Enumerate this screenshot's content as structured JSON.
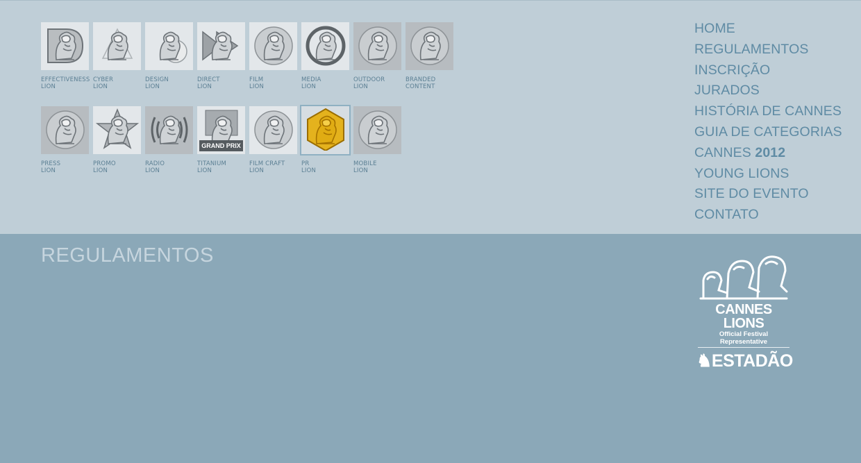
{
  "categories_row1": [
    {
      "l1": "EFFECTIVENESS",
      "l2": "LION",
      "style": "light",
      "icon": "effectiveness-lion-icon"
    },
    {
      "l1": "CYBER",
      "l2": "LION",
      "style": "light",
      "icon": "cyber-lion-icon"
    },
    {
      "l1": "DESIGN",
      "l2": "LION",
      "style": "light",
      "icon": "design-lion-icon"
    },
    {
      "l1": "DIRECT",
      "l2": "LION",
      "style": "light",
      "icon": "direct-lion-icon"
    },
    {
      "l1": "FILM",
      "l2": "LION",
      "style": "light",
      "icon": "film-lion-icon"
    },
    {
      "l1": "MEDIA",
      "l2": "LION",
      "style": "light",
      "icon": "media-lion-icon"
    },
    {
      "l1": "OUTDOOR",
      "l2": "LION",
      "style": "mid",
      "icon": "outdoor-lion-icon"
    },
    {
      "l1": "BRANDED",
      "l2": "CONTENT",
      "style": "mid",
      "icon": "branded-content-lion-icon"
    }
  ],
  "categories_row2": [
    {
      "l1": "PRESS",
      "l2": "LION",
      "style": "mid",
      "icon": "press-lion-icon"
    },
    {
      "l1": "PROMO",
      "l2": "LION",
      "style": "light",
      "icon": "promo-lion-icon"
    },
    {
      "l1": "RADIO",
      "l2": "LION",
      "style": "mid",
      "icon": "radio-lion-icon"
    },
    {
      "l1": "TITANIUM",
      "l2": "LION",
      "style": "light",
      "icon": "titanium-lion-icon",
      "band": "GRAND PRIX"
    },
    {
      "l1": "FILM CRAFT",
      "l2": "LION",
      "style": "light",
      "icon": "film-craft-lion-icon"
    },
    {
      "l1": "PR",
      "l2": "LION",
      "style": "sel",
      "icon": "pr-lion-icon"
    },
    {
      "l1": "MOBILE",
      "l2": "LION",
      "style": "mid",
      "icon": "mobile-lion-icon"
    }
  ],
  "nav": {
    "home": "HOME",
    "regulamentos": "REGULAMENTOS",
    "inscricao": "INSCRIÇÃO",
    "jurados": "JURADOS",
    "historia": "HISTÓRIA DE CANNES",
    "guia": "GUIA DE CATEGORIAS",
    "cannes_prefix": "CANNES",
    "cannes_year": "2012",
    "young": "YOUNG LIONS",
    "site": "SITE DO EVENTO",
    "contato": "CONTATO"
  },
  "page_title": "REGULAMENTOS",
  "logo": {
    "line1": "CANNES LIONS",
    "line2": "Official Festival Representative",
    "line3": "ESTADÃO",
    "icon": "cannes-lions-logo-icon"
  },
  "colors": {
    "top_bg": "#bfced7",
    "bottom_bg": "#8ba8b8",
    "nav_text": "#5f8ba4",
    "caption_text": "#5b7f93",
    "heading_text": "#c6d5de",
    "gold": "#d8a300"
  }
}
